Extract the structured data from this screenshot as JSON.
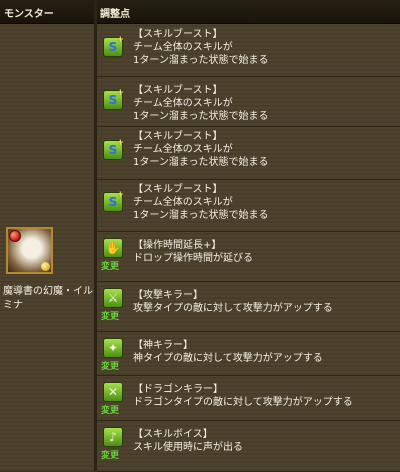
{
  "header": {
    "monster_col": "モンスター",
    "change_col": "調整点"
  },
  "monster": {
    "name": "魔導書の幻魔・イルミナ"
  },
  "rows": [
    {
      "lines": [
        "【スキルブースト】",
        "チーム全体のスキルが",
        "1ターン溜まった状態で始まる"
      ],
      "icon": "skill-boost-icon",
      "badge": ""
    },
    {
      "lines": [
        "【スキルブースト】",
        "チーム全体のスキルが",
        "1ターン溜まった状態で始まる"
      ],
      "icon": "skill-boost-icon",
      "badge": ""
    },
    {
      "lines": [
        "【スキルブースト】",
        "チーム全体のスキルが",
        "1ターン溜まった状態で始まる"
      ],
      "icon": "skill-boost-icon",
      "badge": ""
    },
    {
      "lines": [
        "【スキルブースト】",
        "チーム全体のスキルが",
        "1ターン溜まった状態で始まる"
      ],
      "icon": "skill-boost-icon",
      "badge": ""
    },
    {
      "lines": [
        "【操作時間延長+】",
        "ドロップ操作時間が延びる"
      ],
      "icon": "move-time-extend-icon",
      "badge": "変更"
    },
    {
      "lines": [
        "【攻撃キラー】",
        "攻撃タイプの敵に対して攻撃力がアップする"
      ],
      "icon": "attacker-killer-icon",
      "badge": "変更"
    },
    {
      "lines": [
        "【神キラー】",
        "神タイプの敵に対して攻撃力がアップする"
      ],
      "icon": "god-killer-icon",
      "badge": "変更"
    },
    {
      "lines": [
        "【ドラゴンキラー】",
        "ドラゴンタイプの敵に対して攻撃力がアップする"
      ],
      "icon": "dragon-killer-icon",
      "badge": "変更"
    },
    {
      "lines": [
        "【スキルボイス】",
        "スキル使用時に声が出る"
      ],
      "icon": "skill-voice-icon",
      "badge": "変更"
    }
  ]
}
